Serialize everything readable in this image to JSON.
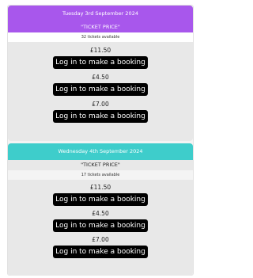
{
  "events": [
    {
      "date": "Tuesday 3rd September 2024",
      "ticket_price_label": "\"TICKET PRICE\"",
      "availability": "32 tickets available",
      "prices": [
        "£11.50",
        "£4.50",
        "£7.00"
      ],
      "button_label": "Log in to make a booking",
      "accent_color": "#a857ec"
    },
    {
      "date": "Wednesday 4th September 2024",
      "ticket_price_label": "\"TICKET PRICE\"",
      "availability": "17 tickets available",
      "prices": [
        "£11.50",
        "£4.50",
        "£7.00"
      ],
      "button_label": "Log in to make a booking",
      "accent_color": "#3ecdcb"
    }
  ]
}
